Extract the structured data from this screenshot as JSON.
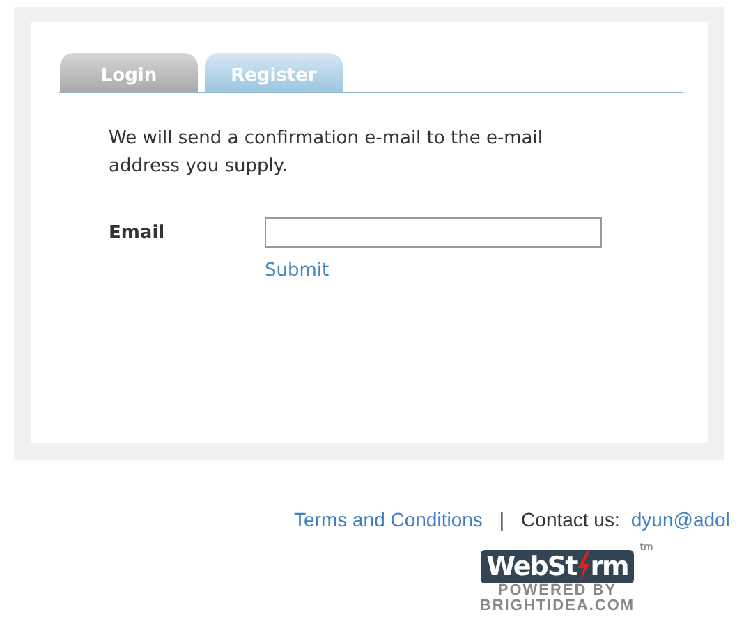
{
  "tabs": [
    {
      "label": "Login",
      "selected": false
    },
    {
      "label": "Register",
      "selected": true
    }
  ],
  "intro": "We will send a confirmation e-mail to the e-mail address you supply.",
  "form": {
    "label": "Email",
    "submit": "Submit"
  },
  "footer": {
    "terms": "Terms and Conditions",
    "separator": "|",
    "contact_label": "Contact us:",
    "contact_email": "dyun@adol"
  },
  "logo": {
    "name_left": "WebSt",
    "name_right": "rm",
    "trademark": "tm",
    "line_1": "POWERED BY",
    "line_2": "BRIGHTIDEA.COM"
  }
}
